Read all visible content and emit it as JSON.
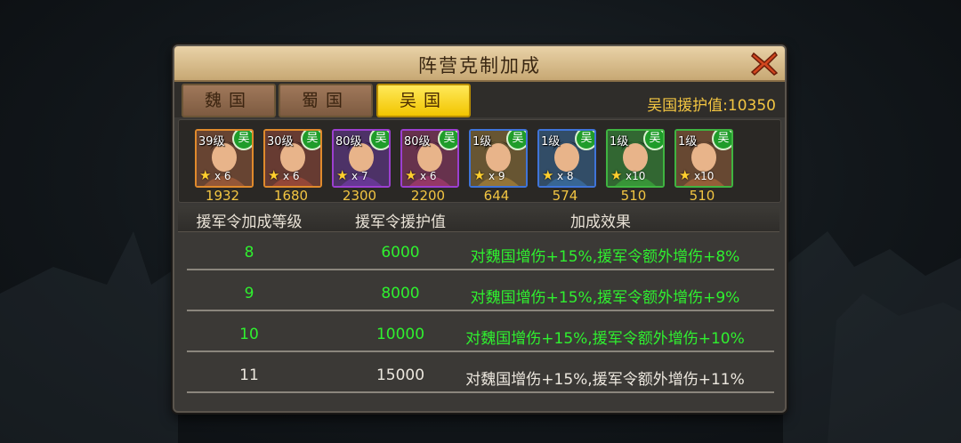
{
  "dialog": {
    "title": "阵营克制加成",
    "tabs": [
      {
        "label": "魏国",
        "active": false
      },
      {
        "label": "蜀国",
        "active": false
      },
      {
        "label": "吴国",
        "active": true
      }
    ],
    "aid_value_text": "吴国援护值:10350"
  },
  "heroes": [
    {
      "level": "39级",
      "faction": "吴",
      "count": "x 6",
      "power": "1932",
      "quality": "orange",
      "icon": "hero-portrait"
    },
    {
      "level": "30级",
      "faction": "吴",
      "count": "x 6",
      "power": "1680",
      "quality": "orange",
      "icon": "hero-portrait"
    },
    {
      "level": "80级",
      "faction": "吴",
      "count": "x 7",
      "power": "2300",
      "quality": "purple",
      "icon": "hero-portrait"
    },
    {
      "level": "80级",
      "faction": "吴",
      "count": "x 6",
      "power": "2200",
      "quality": "purple",
      "icon": "hero-portrait"
    },
    {
      "level": "1级",
      "faction": "吴",
      "count": "x 9",
      "power": "644",
      "quality": "blue",
      "icon": "hero-portrait"
    },
    {
      "level": "1级",
      "faction": "吴",
      "count": "x 8",
      "power": "574",
      "quality": "blue",
      "icon": "hero-portrait"
    },
    {
      "level": "1级",
      "faction": "吴",
      "count": "x10",
      "power": "510",
      "quality": "green",
      "icon": "hero-portrait"
    },
    {
      "level": "1级",
      "faction": "吴",
      "count": "x10",
      "power": "510",
      "quality": "green",
      "icon": "hero-portrait"
    }
  ],
  "table": {
    "headers": [
      "援军令加成等级",
      "援军令援护值",
      "加成效果"
    ],
    "rows": [
      {
        "level": "8",
        "value": "6000",
        "effect": "对魏国增伤+15%,援军令额外增伤+8%",
        "status": "achieved"
      },
      {
        "level": "9",
        "value": "8000",
        "effect": "对魏国增伤+15%,援军令额外增伤+9%",
        "status": "achieved"
      },
      {
        "level": "10",
        "value": "10000",
        "effect": "对魏国增伤+15%,援军令额外增伤+10%",
        "status": "achieved"
      },
      {
        "level": "11",
        "value": "15000",
        "effect": "对魏国增伤+15%,援军令额外增伤+11%",
        "status": "locked"
      }
    ]
  },
  "colors": {
    "achieved": "#2ff02f",
    "locked": "#ece7de",
    "gold": "#f2c542",
    "active_tab": "#f2c500"
  },
  "icons": {
    "close": "close-x-icon",
    "star": "star-icon",
    "faction_badge": "wu-faction-badge"
  }
}
